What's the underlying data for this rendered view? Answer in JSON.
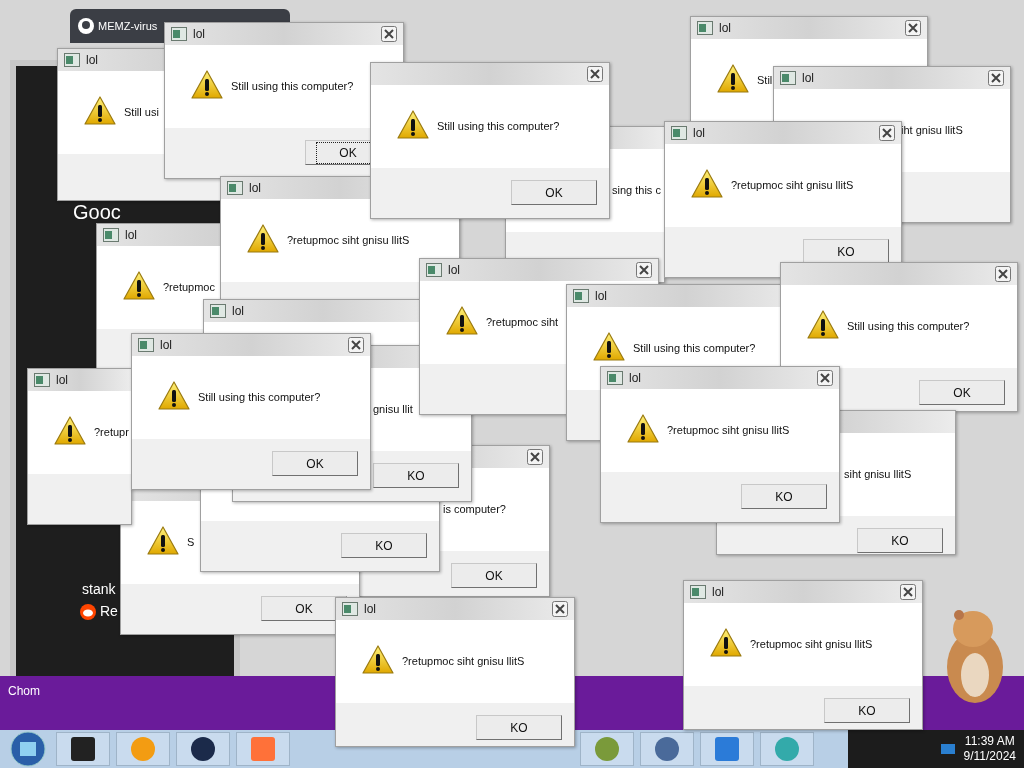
{
  "browser_tab": {
    "title": "MEMZ-virus"
  },
  "background_fragments": [
    "Gooc",
    "stank",
    "Re",
    "Chom"
  ],
  "dialogs": [
    {
      "title": "lol",
      "message": "Stil"
    },
    {
      "title": "lol",
      "message": "iht gnisu llitS"
    },
    {
      "message": "sing this c"
    },
    {
      "title": "lol",
      "message": "?retupmoc"
    },
    {
      "title": "lol",
      "message": "Still usi"
    },
    {
      "title": "lol",
      "message": "Still using this computer?",
      "button": "OK",
      "focused": true
    },
    {
      "title": "lol",
      "message": "?retupmoc siht gnisu llitS"
    },
    {
      "message": "Still using this computer?",
      "button": "OK",
      "focused": false
    },
    {
      "title": "lol"
    },
    {
      "message": "is computer?",
      "button": "OK",
      "focused": false
    },
    {
      "message": "S",
      "button": "OK",
      "focused": false
    },
    {
      "message": "gnisu llit",
      "button": "KO",
      "focused": false
    },
    {
      "button": "KO",
      "focused": false
    },
    {
      "title": "lol",
      "message": "?retupr"
    },
    {
      "title": "lol",
      "message": "Still using this computer?",
      "button": "OK",
      "focused": false
    },
    {
      "title": "lol",
      "message": "?retupmoc siht"
    },
    {
      "title": "lol",
      "message": "Still using this computer?"
    },
    {
      "title": "lol",
      "message": "?retupmoc siht gnisu llitS",
      "button": "KO",
      "focused": false
    },
    {
      "message": "Still using this computer?",
      "button": "OK",
      "focused": false
    },
    {
      "message": "siht gnisu llitS",
      "button": "KO",
      "focused": false
    },
    {
      "title": "lol",
      "message": "?retupmoc siht gnisu llitS",
      "button": "KO",
      "focused": false
    },
    {
      "title": "lol",
      "message": "?retupmoc siht gnisu llitS",
      "button": "KO",
      "focused": false
    },
    {
      "title": "lol",
      "message": "?retupmoc siht gnisu llitS",
      "button": "KO",
      "focused": false
    }
  ],
  "taskbar": {
    "time": "11:39 AM",
    "date": "9/11/2024"
  }
}
